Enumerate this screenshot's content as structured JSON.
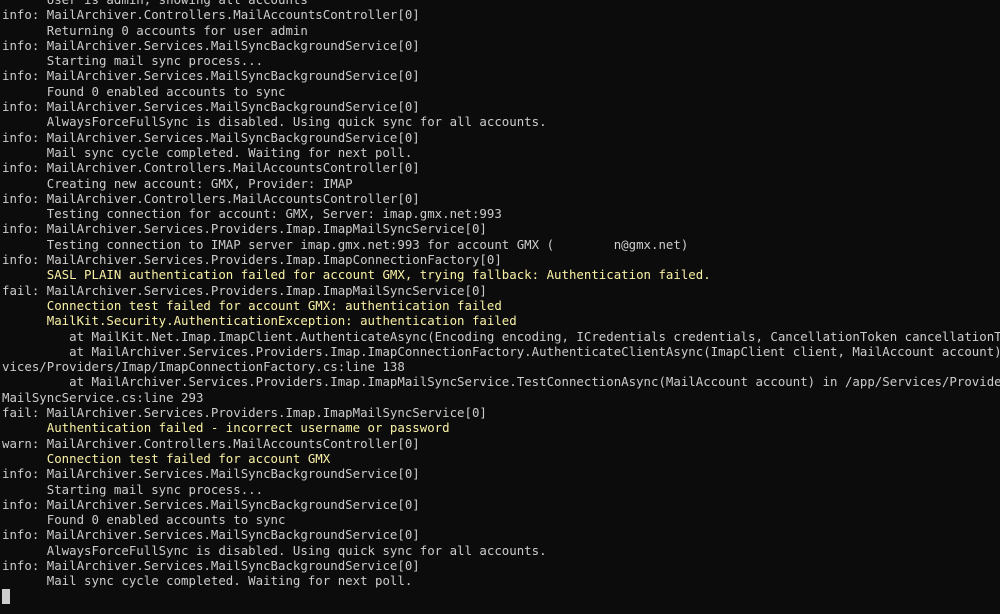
{
  "terminal": {
    "lines": [
      {
        "text": "      User is admin, showing all accounts",
        "style": "normal"
      },
      {
        "text": "info: MailArchiver.Controllers.MailAccountsController[0]",
        "style": "normal"
      },
      {
        "text": "      Returning 0 accounts for user admin",
        "style": "normal"
      },
      {
        "text": "info: MailArchiver.Services.MailSyncBackgroundService[0]",
        "style": "normal"
      },
      {
        "text": "      Starting mail sync process...",
        "style": "normal"
      },
      {
        "text": "info: MailArchiver.Services.MailSyncBackgroundService[0]",
        "style": "normal"
      },
      {
        "text": "      Found 0 enabled accounts to sync",
        "style": "normal"
      },
      {
        "text": "info: MailArchiver.Services.MailSyncBackgroundService[0]",
        "style": "normal"
      },
      {
        "text": "      AlwaysForceFullSync is disabled. Using quick sync for all accounts.",
        "style": "normal"
      },
      {
        "text": "info: MailArchiver.Services.MailSyncBackgroundService[0]",
        "style": "normal"
      },
      {
        "text": "      Mail sync cycle completed. Waiting for next poll.",
        "style": "normal"
      },
      {
        "text": "info: MailArchiver.Controllers.MailAccountsController[0]",
        "style": "normal"
      },
      {
        "text": "      Creating new account: GMX, Provider: IMAP",
        "style": "normal"
      },
      {
        "text": "info: MailArchiver.Controllers.MailAccountsController[0]",
        "style": "normal"
      },
      {
        "text": "      Testing connection for account: GMX, Server: imap.gmx.net:993",
        "style": "normal"
      },
      {
        "text": "info: MailArchiver.Services.Providers.Imap.ImapMailSyncService[0]",
        "style": "normal"
      },
      {
        "text": "      Testing connection to IMAP server imap.gmx.net:993 for account GMX (",
        "style": "normal",
        "redacted": "xxxxxxxx",
        "suffix": "n@gmx.net)"
      },
      {
        "text": "info: MailArchiver.Services.Providers.Imap.ImapConnectionFactory[0]",
        "style": "normal"
      },
      {
        "text": "      SASL PLAIN authentication failed for account GMX, trying fallback: Authentication failed.",
        "style": "warn"
      },
      {
        "text": "fail: MailArchiver.Services.Providers.Imap.ImapMailSyncService[0]",
        "style": "normal"
      },
      {
        "text": "      Connection test failed for account GMX: authentication failed",
        "style": "warn"
      },
      {
        "text": "      MailKit.Security.AuthenticationException: authentication failed",
        "style": "warn"
      },
      {
        "text": "         at MailKit.Net.Imap.ImapClient.AuthenticateAsync(Encoding encoding, ICredentials credentials, CancellationToken cancellationToken)",
        "style": "normal"
      },
      {
        "text": "         at MailArchiver.Services.Providers.Imap.ImapConnectionFactory.AuthenticateClientAsync(ImapClient client, MailAccount account) in /app/Ser",
        "style": "normal"
      },
      {
        "text": "vices/Providers/Imap/ImapConnectionFactory.cs:line 138",
        "style": "normal"
      },
      {
        "text": "         at MailArchiver.Services.Providers.Imap.ImapMailSyncService.TestConnectionAsync(MailAccount account) in /app/Services/Providers/Imap/Imap",
        "style": "normal"
      },
      {
        "text": "MailSyncService.cs:line 293",
        "style": "normal"
      },
      {
        "text": "fail: MailArchiver.Services.Providers.Imap.ImapMailSyncService[0]",
        "style": "normal"
      },
      {
        "text": "      Authentication failed - incorrect username or password",
        "style": "warn"
      },
      {
        "text": "warn: MailArchiver.Controllers.MailAccountsController[0]",
        "style": "normal"
      },
      {
        "text": "      Connection test failed for account GMX",
        "style": "warn"
      },
      {
        "text": "info: MailArchiver.Services.MailSyncBackgroundService[0]",
        "style": "normal"
      },
      {
        "text": "      Starting mail sync process...",
        "style": "normal"
      },
      {
        "text": "info: MailArchiver.Services.MailSyncBackgroundService[0]",
        "style": "normal"
      },
      {
        "text": "      Found 0 enabled accounts to sync",
        "style": "normal"
      },
      {
        "text": "info: MailArchiver.Services.MailSyncBackgroundService[0]",
        "style": "normal"
      },
      {
        "text": "      AlwaysForceFullSync is disabled. Using quick sync for all accounts.",
        "style": "normal"
      },
      {
        "text": "info: MailArchiver.Services.MailSyncBackgroundService[0]",
        "style": "normal"
      },
      {
        "text": "      Mail sync cycle completed. Waiting for next poll.",
        "style": "normal"
      }
    ],
    "colors": {
      "background": "#0c0c0c",
      "text": "#cccccc",
      "warning": "#f9f1a5"
    }
  }
}
